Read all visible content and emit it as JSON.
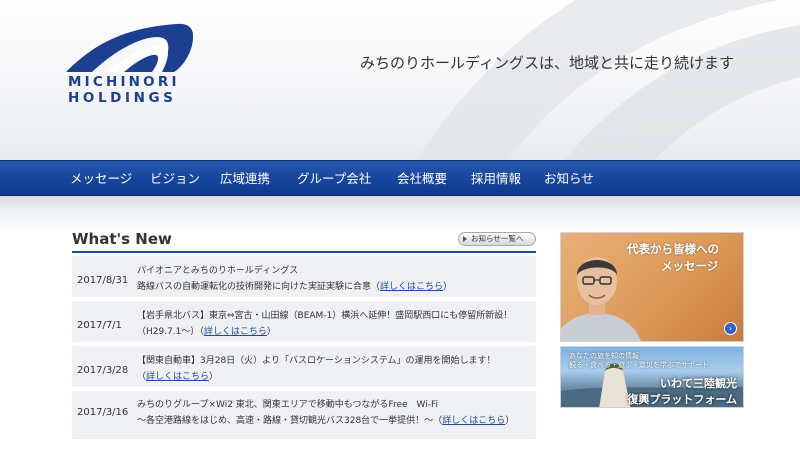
{
  "brand": {
    "name_line1": "MICHINORI",
    "name_line2": "HOLDINGS",
    "tagline": "みちのりホールディングスは、地域と共に走り続けます",
    "colors": {
      "primary": "#1d3f8f",
      "nav": "#1846a0",
      "link": "#1d4a9a"
    }
  },
  "nav": {
    "items": [
      {
        "label": "メッセージ"
      },
      {
        "label": "ビジョン"
      },
      {
        "label": "広域連携"
      },
      {
        "label": "グループ会社"
      },
      {
        "label": "会社概要"
      },
      {
        "label": "採用情報"
      },
      {
        "label": "お知らせ"
      }
    ]
  },
  "news": {
    "title": "What's New",
    "more_label": "お知らせ一覧へ",
    "link_label": "詳しくはこちら",
    "items": [
      {
        "date": "2017/8/31",
        "line1": "パイオニアとみちのりホールディングス",
        "line2": "路線バスの自動運転化の技術開発に向けた実証実験に合意（",
        "line2_end": "）"
      },
      {
        "date": "2017/7/1",
        "line1": "【岩手県北バス】東京⇔宮古・山田線（BEAM-1）横浜へ延伸！盛岡駅西口にも停留所新設！",
        "line2": "（H29.7.1〜）（",
        "line2_end": "）"
      },
      {
        "date": "2017/3/28",
        "line1": "【関東自動車】3月28日（火）より「バスロケーションシステム」の運用を開始します！",
        "line2": "（",
        "line2_end": "）"
      },
      {
        "date": "2017/3/16",
        "line1": "みちのりグループ×Wi2 東北、関東エリアで移動中もつながるFree　Wi-Fi",
        "line2": "〜各空港路線をはじめ、高速・路線・貸切観光バス328台で一挙提供！〜（",
        "line2_end": "）"
      }
    ]
  },
  "banners": {
    "message_line1": "代表から皆様への",
    "message_line2": "メッセージ",
    "iwate_small1": "あなたの旅を知の情報",
    "iwate_small2": "観る・食べる・遊ぶ・震災を学ぶでサポート",
    "iwate_big1": "いわて三陸観光",
    "iwate_big2": "復興プラットフォーム"
  }
}
